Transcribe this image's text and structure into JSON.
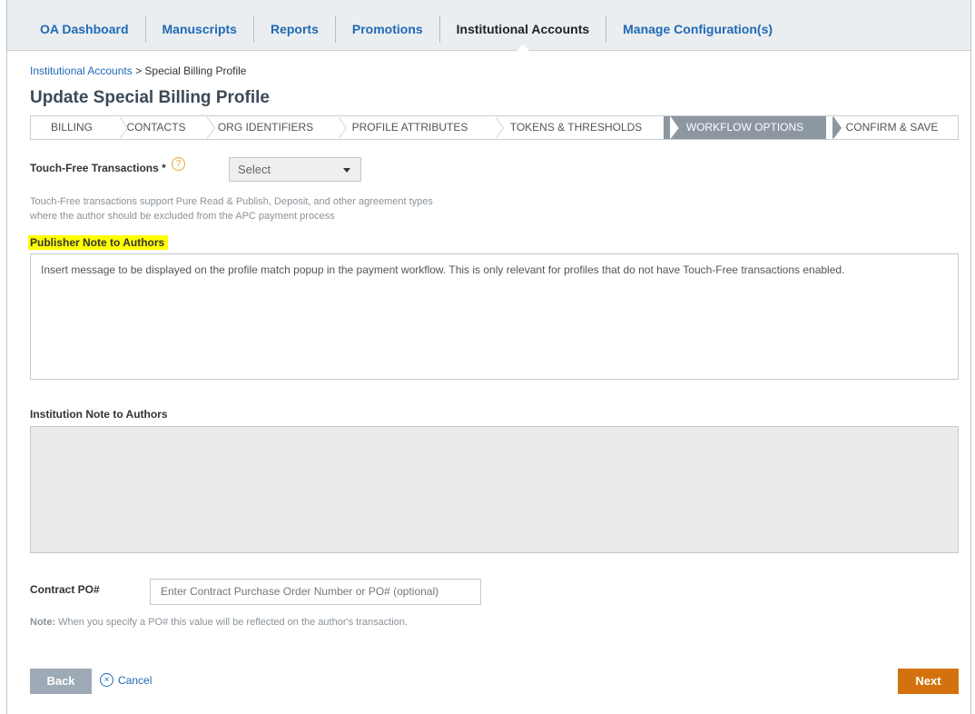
{
  "nav": {
    "tabs": [
      {
        "label": "OA Dashboard"
      },
      {
        "label": "Manuscripts"
      },
      {
        "label": "Reports"
      },
      {
        "label": "Promotions"
      },
      {
        "label": "Institutional Accounts"
      },
      {
        "label": "Manage Configuration(s)"
      }
    ],
    "active_tab": "Institutional Accounts"
  },
  "breadcrumb": {
    "parent": "Institutional Accounts",
    "separator": " > ",
    "current": "Special Billing Profile"
  },
  "page_title": "Update Special Billing Profile",
  "steps": [
    {
      "label": "BILLING"
    },
    {
      "label": "CONTACTS"
    },
    {
      "label": "ORG IDENTIFIERS"
    },
    {
      "label": "PROFILE ATTRIBUTES"
    },
    {
      "label": "TOKENS & THRESHOLDS"
    },
    {
      "label": "WORKFLOW OPTIONS"
    },
    {
      "label": "CONFIRM & SAVE"
    }
  ],
  "active_step": "WORKFLOW OPTIONS",
  "touch_free": {
    "label": "Touch-Free Transactions *",
    "help_icon": "?",
    "select_value": "Select",
    "help_line1": "Touch-Free transactions support Pure Read & Publish, Deposit, and other agreement types",
    "help_line2": "where the author should be excluded from the APC payment process"
  },
  "publisher_note": {
    "label": "Publisher Note to Authors",
    "text": "Insert message to be displayed on the profile match popup in the payment workflow. This is only relevant for profiles that do not have Touch-Free transactions enabled."
  },
  "institution_note": {
    "label": "Institution Note to Authors",
    "text": ""
  },
  "contract_po": {
    "label": "Contract PO#",
    "placeholder": "Enter Contract Purchase Order Number or PO# (optional)",
    "note_bold": "Note:",
    "note_text": " When you specify a PO# this value will be reflected on the author's transaction."
  },
  "footer": {
    "back_label": "Back",
    "cancel_icon": "×",
    "cancel_label": "Cancel",
    "next_label": "Next"
  },
  "colors": {
    "link_blue": "#1e6ab5",
    "next_orange": "#d3720d",
    "highlight_yellow": "#ffff00",
    "active_step_gray": "#8c97a2"
  }
}
